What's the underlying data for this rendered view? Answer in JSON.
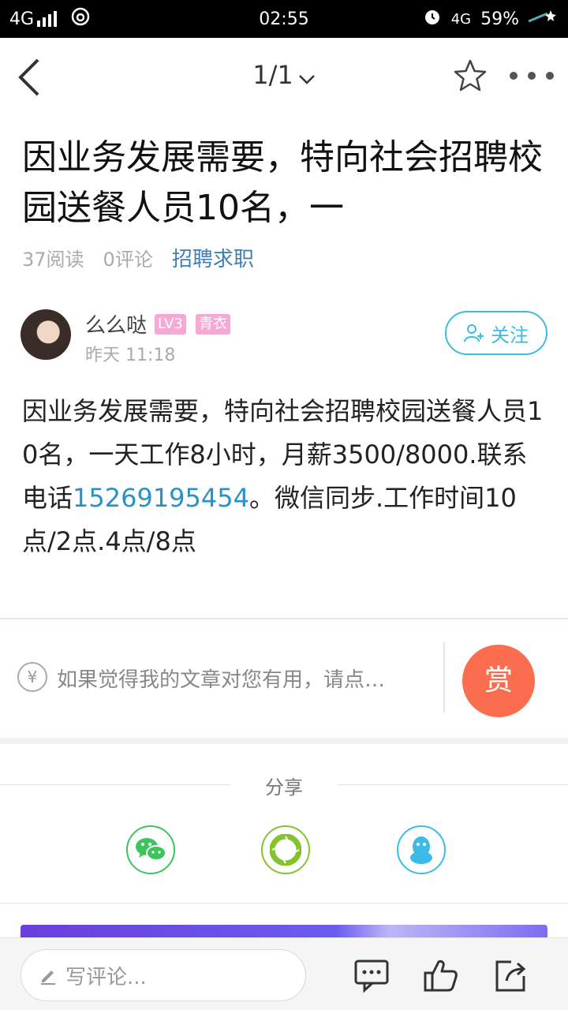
{
  "status_bar": {
    "network": "4G",
    "time": "02:55",
    "network_right": "4G",
    "battery": "59%"
  },
  "nav": {
    "page_indicator": "1/1"
  },
  "article": {
    "title": "因业务发展需要，特向社会招聘校园送餐人员10名，一",
    "reads": "37阅读",
    "comments": "0评论",
    "category": "招聘求职",
    "body_before_phone": "因业务发展需要，特向社会招聘校园送餐人员10名，一天工作8小时，月薪3500/8000.联系电话",
    "phone": "15269195454",
    "body_after_phone": "。微信同步.工作时间10点/2点.4点/8点"
  },
  "author": {
    "name": "么么哒",
    "level": "LV3",
    "title": "青衣",
    "time": "昨天 11:18",
    "follow_label": "关注"
  },
  "reward": {
    "currency_symbol": "¥",
    "prompt": "如果觉得我的文章对您有用，请点…",
    "button_label": "赏"
  },
  "share": {
    "label": "分享",
    "targets": [
      "wechat-icon",
      "moments-icon",
      "qq-icon"
    ]
  },
  "bottom_bar": {
    "comment_placeholder": "写评论..."
  },
  "colors": {
    "accent_blue": "#3bbde0",
    "link_blue": "#2a91c8",
    "reward_orange": "#fa6d4f",
    "badge_pink": "#f7a8d4"
  }
}
